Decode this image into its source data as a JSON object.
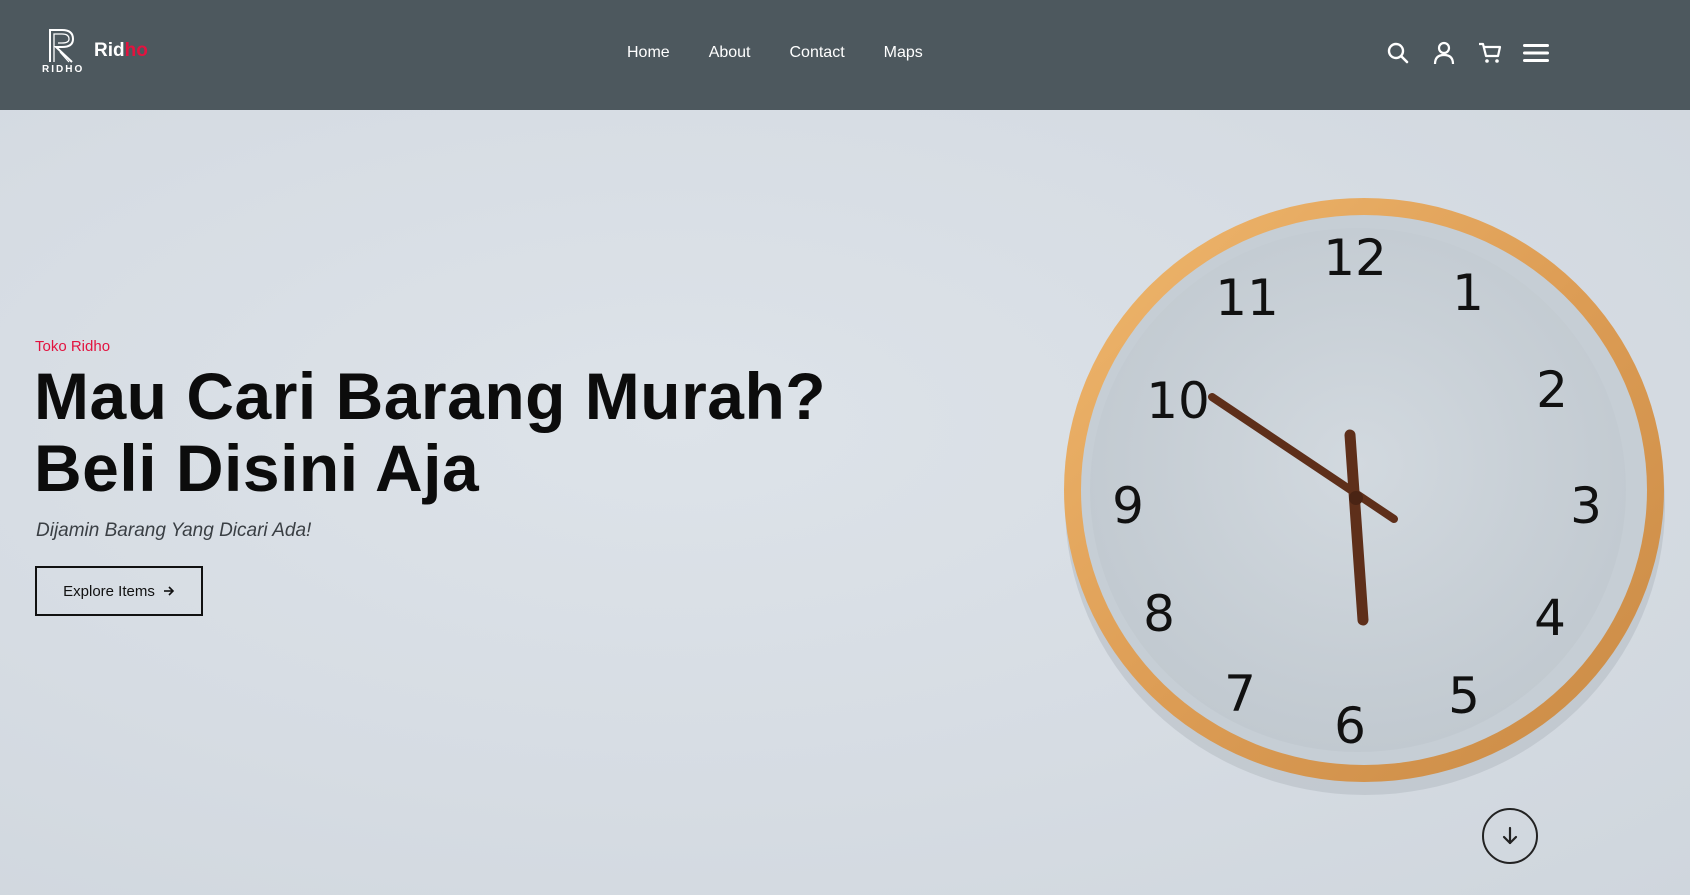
{
  "brand": {
    "mark_text": "RIDHO",
    "name_part1": "Rid",
    "name_part2": "ho",
    "accent_color": "#e2133f"
  },
  "nav": {
    "links": [
      "Home",
      "About",
      "Contact",
      "Maps"
    ],
    "icons": [
      "search-icon",
      "user-icon",
      "cart-icon",
      "menu-icon"
    ],
    "background": "#4d585e"
  },
  "hero": {
    "eyebrow": "Toko Ridho",
    "headline_line1": "Mau Cari Barang Murah?",
    "headline_line2": "Beli Disini Aja",
    "subheadline": "Dijamin Barang Yang Dicari Ada!",
    "cta_label": "Explore Items",
    "cta_icon": "arrow-right-icon",
    "scroll_icon": "arrow-down-icon"
  },
  "clock": {
    "numerals": [
      "12",
      "1",
      "2",
      "3",
      "4",
      "5",
      "6",
      "7",
      "8",
      "9",
      "10",
      "11"
    ],
    "frame_color": "#e3a25a"
  }
}
